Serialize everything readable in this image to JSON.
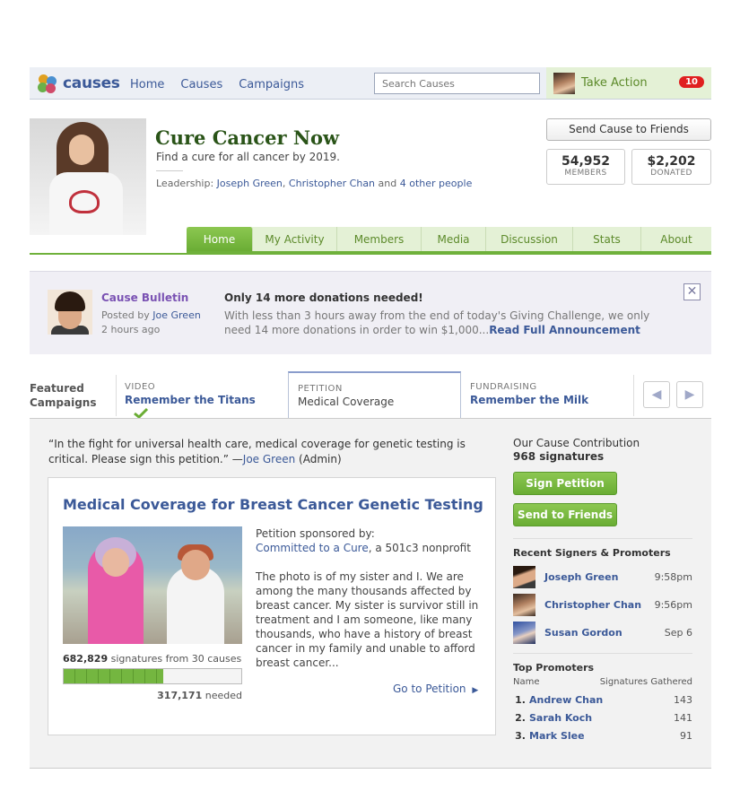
{
  "topbar": {
    "logo_text": "causes",
    "nav": [
      "Home",
      "Causes",
      "Campaigns"
    ],
    "search_placeholder": "Search Causes",
    "take_action": "Take Action",
    "notifications": "10"
  },
  "cause": {
    "title": "Cure Cancer Now",
    "subtitle": "Find a cure for all cancer by 2019.",
    "leadership_label": "Leadership:",
    "leader1": "Joseph Green",
    "comma": ",",
    "leader2": "Christopher Chan",
    "and": "and",
    "others": "4 other people",
    "send_button": "Send Cause to Friends",
    "members_value": "54,952",
    "members_label": "MEMBERS",
    "donated_value": "$2,202",
    "donated_label": "DONATED"
  },
  "tabs": [
    "Home",
    "My Activity",
    "Members",
    "Media",
    "Discussion",
    "Stats",
    "About"
  ],
  "bulletin": {
    "title": "Cause Bulletin",
    "posted_by_label": "Posted by",
    "posted_by": "Joe Green",
    "time": "2 hours ago",
    "headline": "Only 14 more donations needed!",
    "body": "With less than 3 hours away from the end of today's Giving Challenge, we only need 14 more donations in order to win $1,000...",
    "read_more": "Read Full Announcement",
    "close": "✕"
  },
  "featured": {
    "label_line1": "Featured",
    "label_line2": "Campaigns",
    "items": [
      {
        "kind": "VIDEO",
        "name": "Remember the Titans"
      },
      {
        "kind": "PETITION",
        "name": "Medical Coverage"
      },
      {
        "kind": "FUNDRAISING",
        "name": "Remember the Milk"
      }
    ],
    "prev": "◀",
    "next": "▶"
  },
  "petition": {
    "quote": "“In the fight for universal health care, medical coverage for genetic testing is critical. Please sign this petition.” —",
    "quote_author": "Joe Green",
    "quote_role": "(Admin)",
    "title": "Medical Coverage for Breast Cancer Genetic Testing",
    "sponsored_label": "Petition sponsored by:",
    "sponsor": "Committed to a Cure",
    "sponsor_suffix": ", a 501c3 nonprofit",
    "description": "The photo is of my sister and I. We are among the many thousands affected by breast cancer. My sister is survivor still in treatment and I am someone, like many thousands, who have a history of breast cancer in my family and unable to afford breast cancer...",
    "signatures": "682,829",
    "signatures_suffix": "signatures from 30 causes",
    "progress_fraction": 0.56,
    "needed": "317,171",
    "needed_suffix": "needed",
    "go_link": "Go to Petition"
  },
  "sidebar": {
    "contribution_label": "Our Cause Contribution",
    "contribution_value": "968 signatures",
    "sign_button": "Sign Petition",
    "send_button": "Send to Friends",
    "recent_head": "Recent Signers & Promoters",
    "signers": [
      {
        "name": "Joseph Green",
        "time": "9:58pm"
      },
      {
        "name": "Christopher Chan",
        "time": "9:56pm"
      },
      {
        "name": "Susan Gordon",
        "time": "Sep 6"
      }
    ],
    "top_head": "Top Promoters",
    "col_name": "Name",
    "col_sig": "Signatures Gathered",
    "promoters": [
      {
        "rank": "1.",
        "name": "Andrew Chan",
        "count": "143"
      },
      {
        "rank": "2.",
        "name": "Sarah Koch",
        "count": "141"
      },
      {
        "rank": "3.",
        "name": "Mark Slee",
        "count": "91"
      }
    ]
  }
}
